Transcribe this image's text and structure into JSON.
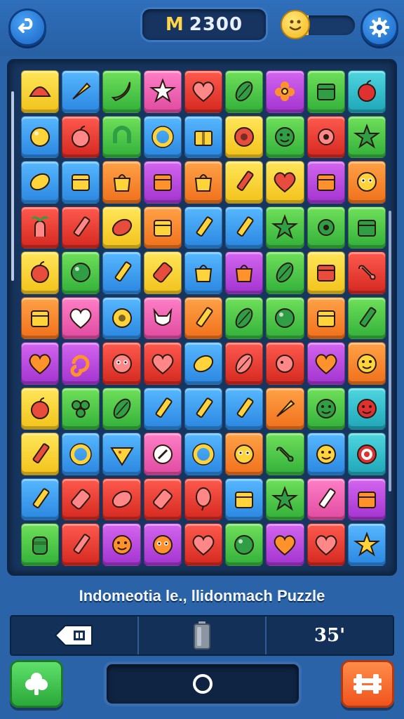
{
  "hud": {
    "score_prefix": "M",
    "score_value": "2300",
    "progress_fraction": 0.25,
    "back_icon": "undo-arrow-icon",
    "settings_icon": "gear-icon",
    "mood_icon": "smiley-face-icon"
  },
  "caption": "Indomeotia le., llidonmach Puzzle",
  "bottom_bar": {
    "left_icon": "hint-ticket-icon",
    "middle_icon": "battery-icon",
    "right_text": "35'"
  },
  "controls": {
    "left_icon": "clover-icon",
    "center_icon": "circle-icon",
    "right_icon": "shuffle-grid-icon"
  },
  "colors": {
    "background": "#2a63a8",
    "board": "#16355f",
    "score_accent": "#ffd54a",
    "left_button": "#3cc94a",
    "right_button": "#ff6a2b"
  },
  "board": {
    "columns": 9,
    "rows": 11,
    "tiles": [
      [
        "yellow:shell",
        "blue:carrot",
        "green:banana",
        "pink:star",
        "red:heart",
        "green:leaf",
        "magenta:flower",
        "green:box",
        "teal:apple"
      ],
      [
        "blue:ball",
        "red:apple",
        "green:horseshoe",
        "blue:ring",
        "blue:gift",
        "yellow:donut",
        "green:smiley",
        "red:gear",
        "green:star"
      ],
      [
        "blue:lemon",
        "blue:box",
        "orange:bag",
        "magenta:box",
        "orange:bag",
        "yellow:pencil",
        "yellow:heart",
        "magenta:box",
        "orange:face"
      ],
      [
        "red:plant",
        "red:pencil",
        "yellow:lemon",
        "orange:box",
        "blue:pencil",
        "blue:pencil",
        "green:star",
        "green:gear",
        "green:box"
      ],
      [
        "yellow:apple",
        "green:ball",
        "blue:pencil",
        "yellow:cylinder",
        "blue:bag",
        "magenta:bag",
        "green:leaf",
        "yellow:box",
        "red:bone"
      ],
      [
        "orange:box",
        "pink:heart",
        "blue:donut",
        "pink:fox",
        "orange:pencil",
        "green:leaf",
        "green:ball",
        "orange:box",
        "green:pencil"
      ],
      [
        "magenta:heart",
        "magenta:swirl",
        "red:face",
        "red:heart",
        "blue:lemon",
        "red:leaf",
        "red:puff",
        "magenta:heart",
        "orange:smiley"
      ],
      [
        "yellow:apple",
        "green:grapes",
        "green:leaf",
        "blue:pencil",
        "blue:pencil",
        "blue:pencil",
        "orange:carrot",
        "green:smiley",
        "teal:smiley"
      ],
      [
        "yellow:pencil",
        "blue:ring",
        "blue:pizza",
        "pink:compass",
        "blue:ring",
        "orange:face",
        "green:bone",
        "blue:smiley",
        "teal:target"
      ],
      [
        "blue:pencil",
        "red:cylinder",
        "red:lemon",
        "red:cylinder",
        "red:balloon",
        "blue:box",
        "green:star",
        "pink:pencil",
        "magenta:box"
      ],
      [
        "green:jar",
        "red:pencil",
        "magenta:smiley",
        "magenta:face",
        "red:heart",
        "green:ball",
        "magenta:heart",
        "red:heart",
        "blue:star"
      ]
    ]
  }
}
